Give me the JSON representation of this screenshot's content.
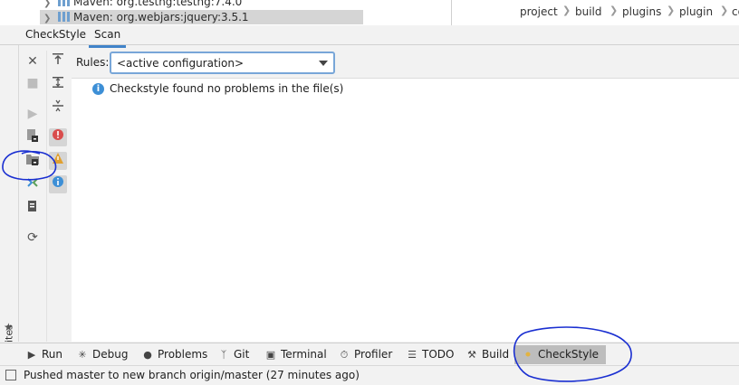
{
  "project_tree": {
    "rows": [
      {
        "label": "Maven: org.testng:testng:7.4.0"
      },
      {
        "label": "Maven: org.webjars:jquery:3.5.1"
      }
    ]
  },
  "breadcrumb": [
    "project",
    "build",
    "plugins",
    "plugin",
    "co"
  ],
  "tool_window": {
    "tabs": [
      {
        "label": "CheckStyle",
        "active": false
      },
      {
        "label": "Scan",
        "active": true
      }
    ]
  },
  "left_toolbar": {
    "buttons": [
      {
        "icon": "close-icon"
      },
      {
        "icon": "stop-icon"
      },
      {
        "icon": "run-icon"
      },
      {
        "icon": "check-file-icon"
      },
      {
        "icon": "check-module-icon"
      },
      {
        "icon": "check-project-icon"
      },
      {
        "icon": "check-changes-icon"
      },
      {
        "icon": "refresh-icon"
      }
    ]
  },
  "second_toolbar": {
    "buttons": [
      {
        "icon": "scroll-to-source-icon"
      },
      {
        "icon": "expand-all-icon"
      },
      {
        "icon": "collapse-all-icon"
      },
      {
        "icon": "error-filter-icon"
      },
      {
        "icon": "warning-filter-icon"
      },
      {
        "icon": "info-filter-icon"
      }
    ]
  },
  "rules": {
    "label": "Rules:",
    "selected": "<active configuration>"
  },
  "results": {
    "message": "Checkstyle found no problems in the file(s)",
    "icon": "info-icon"
  },
  "favorites_label": "Favorites",
  "bottom_tabs": [
    {
      "label": "Run",
      "icon": "run-icon"
    },
    {
      "label": "Debug",
      "icon": "bug-icon"
    },
    {
      "label": "Problems",
      "icon": "problems-icon"
    },
    {
      "label": "Git",
      "icon": "git-icon"
    },
    {
      "label": "Terminal",
      "icon": "terminal-icon"
    },
    {
      "label": "Profiler",
      "icon": "profiler-icon"
    },
    {
      "label": "TODO",
      "icon": "todo-icon"
    },
    {
      "label": "Build",
      "icon": "build-icon"
    },
    {
      "label": "CheckStyle",
      "icon": "checkstyle-icon",
      "active": true
    }
  ],
  "status_bar": {
    "message": "Pushed master to new branch origin/master (27 minutes ago)"
  },
  "colors": {
    "accent": "#4083c9",
    "annotation": "#1a2fd1",
    "error": "#d94c4c",
    "info": "#3d8fd6"
  }
}
